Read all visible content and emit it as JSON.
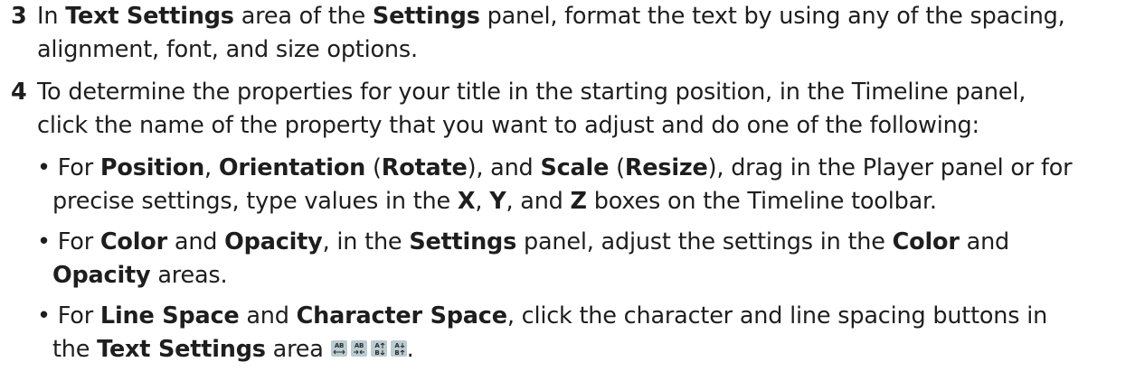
{
  "step3": {
    "number": "3",
    "line1": {
      "p1": "In ",
      "b1": "Text Settings",
      "p2": " area of the ",
      "b2": "Settings",
      "p3": " panel, format the text by using any of the spacing,"
    },
    "line2": "alignment, font, and size options."
  },
  "step4": {
    "number": "4",
    "line1": "To determine the properties for your title in the starting position, in the Timeline panel,",
    "line2": "click the name of the property that you want to adjust and do one of the following:"
  },
  "bullets": [
    {
      "symbol": "•",
      "l1": {
        "p1": " For ",
        "b1": "Position",
        "p2": ", ",
        "b2": "Orientation",
        "p3": " (",
        "b3": "Rotate",
        "p4": "), and ",
        "b4": "Scale",
        "p5": " (",
        "b5": "Resize",
        "p6": "), drag in the Player panel or for"
      },
      "l2": {
        "p1": "precise settings, type values in the ",
        "b1": "X",
        "p2": ", ",
        "b2": "Y",
        "p3": ", and ",
        "b3": "Z",
        "p4": " boxes on the Timeline toolbar."
      }
    },
    {
      "symbol": "•",
      "l1": {
        "p1": " For ",
        "b1": "Color",
        "p2": " and ",
        "b2": "Opacity",
        "p3": ", in the ",
        "b3": "Settings",
        "p4": " panel, adjust the settings in the ",
        "b4": "Color",
        "p5": " and"
      },
      "l2": {
        "b1": "Opacity",
        "p1": " areas."
      }
    },
    {
      "symbol": "•",
      "l1": {
        "p1": " For ",
        "b1": "Line Space",
        "p2": " and ",
        "b2": "Character Space",
        "p3": ", click the character and line spacing buttons in"
      },
      "l2": {
        "p1": "the ",
        "b1": "Text Settings",
        "p2": " area ",
        "p3": "."
      }
    }
  ],
  "spacing_icons": {
    "icons": [
      "tracking-decrease-icon",
      "tracking-increase-icon",
      "leading-decrease-icon",
      "leading-increase-icon"
    ],
    "icon_background": "#b9ccd2",
    "icon_ink": "#2b2b2b"
  }
}
